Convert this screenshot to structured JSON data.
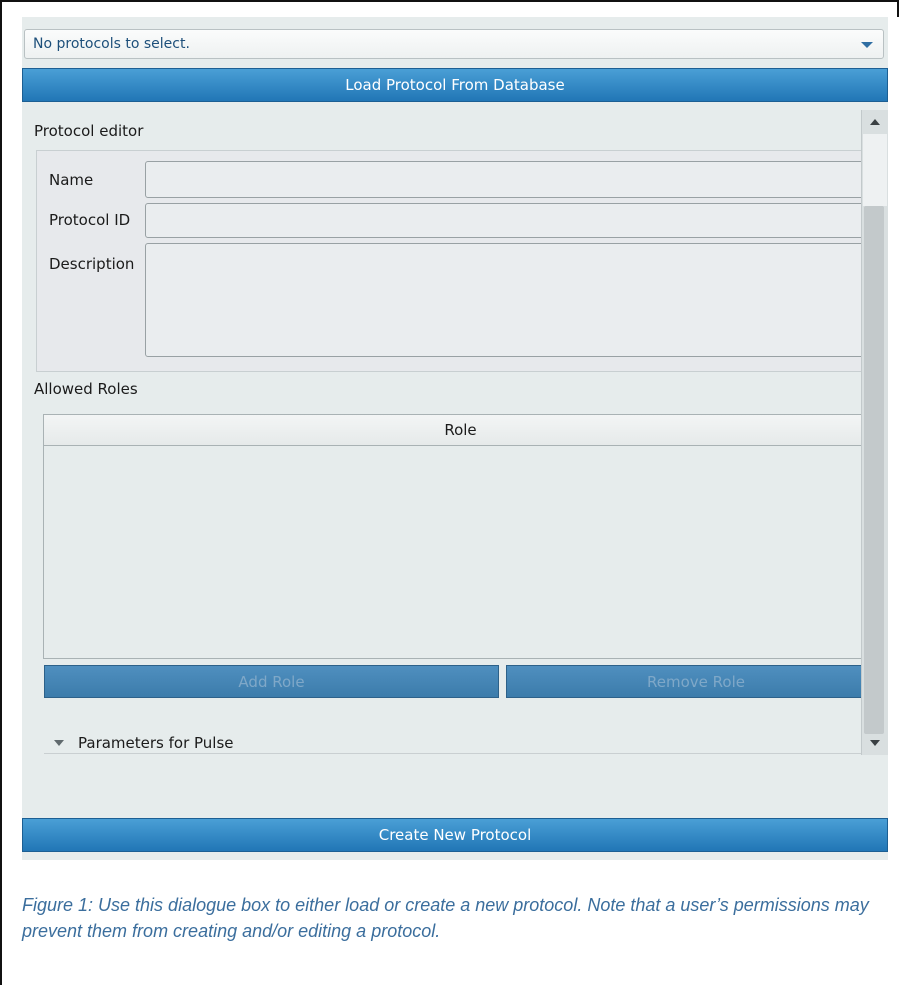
{
  "protocol_select": {
    "value": "No protocols to select."
  },
  "buttons": {
    "load_protocol": "Load Protocol From Database",
    "create_protocol": "Create New Protocol",
    "add_role": "Add Role",
    "remove_role": "Remove Role"
  },
  "editor": {
    "title": "Protocol editor",
    "fields": {
      "name_label": "Name",
      "name_value": "",
      "protocol_id_label": "Protocol ID",
      "protocol_id_value": "",
      "description_label": "Description",
      "description_value": ""
    }
  },
  "roles": {
    "title": "Allowed Roles",
    "columns": [
      "Role"
    ],
    "rows": []
  },
  "parameters": {
    "label": "Parameters for Pulse"
  },
  "caption": "Figure 1: Use this dialogue box to either load or create a new protocol. Note that a user’s permissions may prevent them from creating and/or editing a protocol.",
  "colors": {
    "primary_button": "#2a82c3",
    "panel_background": "#e6ecec",
    "caption_text": "#3b6e9d"
  },
  "icons": {
    "dropdown": "chevron-down-icon",
    "collapse": "triangle-down-icon",
    "scroll_up": "scroll-up-arrow-icon",
    "scroll_down": "scroll-down-arrow-icon"
  }
}
